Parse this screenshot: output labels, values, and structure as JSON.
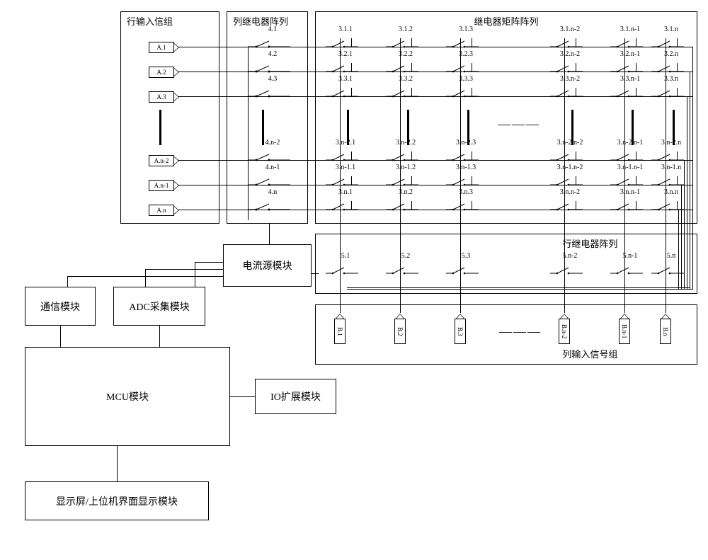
{
  "groups": {
    "row_input": "行输入信组",
    "col_relay_array": "列继电器阵列",
    "relay_matrix": "继电器矩阵阵列",
    "row_relay_array": "行继电器阵列",
    "col_input": "列输入信号组"
  },
  "modules": {
    "current_source": "电流源模块",
    "comm": "通信模块",
    "adc": "ADC采集模块",
    "mcu": "MCU模块",
    "io_expand": "IO扩展模块",
    "display": "显示屏/上位机界面显示模块"
  },
  "row_tags": [
    "A.1",
    "A.2",
    "A.3",
    "A.n-2",
    "A.n-1",
    "A.n"
  ],
  "col_tags": [
    "B.1",
    "B.2",
    "B.3",
    "B.n-2",
    "B.n-1",
    "B.n"
  ],
  "col_relay_labels": [
    "4.1",
    "4.2",
    "4.3",
    "4.n-2",
    "4.n-1",
    "4.n"
  ],
  "row_relay_labels": [
    "5.1",
    "5.2",
    "5.3",
    "5.n-2",
    "5.n-1",
    "5.n"
  ],
  "matrix_rows": [
    [
      "3.1.1",
      "3.1.2",
      "3.1.3",
      "3.1.n-2",
      "3.1.n-1",
      "3.1.n"
    ],
    [
      "3.2.1",
      "3.2.2",
      "3.2.3",
      "3.2.n-2",
      "3.2.n-1",
      "3.2.n"
    ],
    [
      "3.3.1",
      "3.3.2",
      "3.3.3",
      "3.3.n-2",
      "3.3.n-1",
      "3.3.n"
    ],
    [
      "3.n-2.1",
      "3.n-2.2",
      "3.n-2.3",
      "3.n-2.n-2",
      "3.n-2.n-1",
      "3.n-2.n"
    ],
    [
      "3.n-1.1",
      "3.n-1.2",
      "3.n-1.3",
      "3.n-1.n-2",
      "3.n-1.n-1",
      "3.n-1.n"
    ],
    [
      "3.n.1",
      "3.n.2",
      "3.n.3",
      "3.n.n-2",
      "3.n.n-1",
      "3.n.n"
    ]
  ]
}
